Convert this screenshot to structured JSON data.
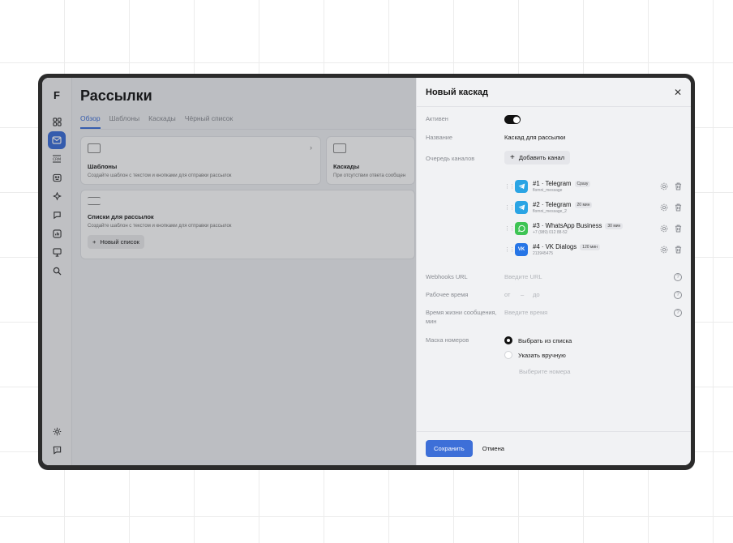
{
  "app": {
    "logo": "F",
    "page_title": "Рассылки",
    "tabs": [
      "Обзор",
      "Шаблоны",
      "Каскады",
      "Чёрный список"
    ],
    "cards": {
      "templates": {
        "title": "Шаблоны",
        "desc": "Создайте шаблон с текстом и кнопками для отправки рассылок"
      },
      "cascades": {
        "title": "Каскады",
        "desc": "При отсутствии ответа сообщен"
      },
      "lists": {
        "title": "Списки для рассылок",
        "desc": "Создайте шаблон с текстом и кнопками для отправки рассылок",
        "button": "Новый список"
      }
    }
  },
  "drawer": {
    "title": "Новый каскад",
    "active_label": "Активен",
    "active": true,
    "name_label": "Название",
    "name_value": "Каскад для рассылки",
    "queue_label": "Очередь каналов",
    "add_channel": "Добавить канал",
    "channels": [
      {
        "name": "#1 · Telegram",
        "badge": "Сразу",
        "sub": "flomni_message",
        "icon": "telegram-icon"
      },
      {
        "name": "#2 · Telegram",
        "badge": "20 мин",
        "sub": "flomni_message_2",
        "icon": "telegram-icon"
      },
      {
        "name": "#3 · WhatsApp Business",
        "badge": "30 мин",
        "sub": "+7 (989) 012 88-52",
        "icon": "whatsapp-icon"
      },
      {
        "name": "#4 · VK Dialogs",
        "badge": "120 мин",
        "sub": "213945475",
        "icon": "vk-icon"
      }
    ],
    "vk_glyph": "VK",
    "webhooks_label": "Webhooks URL",
    "webhooks_placeholder": "Введите URL",
    "worktime_label": "Рабочее время",
    "worktime_from": "от",
    "worktime_dash": "–",
    "worktime_to": "до",
    "ttl_label": "Время жизни сообщения, мин",
    "ttl_placeholder": "Введите время",
    "mask_label": "Маска номеров",
    "mask_options": [
      "Выбрать из списка",
      "Указать вручную"
    ],
    "mask_selected": 0,
    "mask_placeholder": "Выберите номера",
    "save": "Сохранить",
    "cancel": "Отмена",
    "help_glyph": "?"
  },
  "colors": {
    "accent": "#3d6fd8",
    "telegram": "#2aa4e4",
    "whatsapp": "#3ec454",
    "vk": "#2675e6"
  }
}
